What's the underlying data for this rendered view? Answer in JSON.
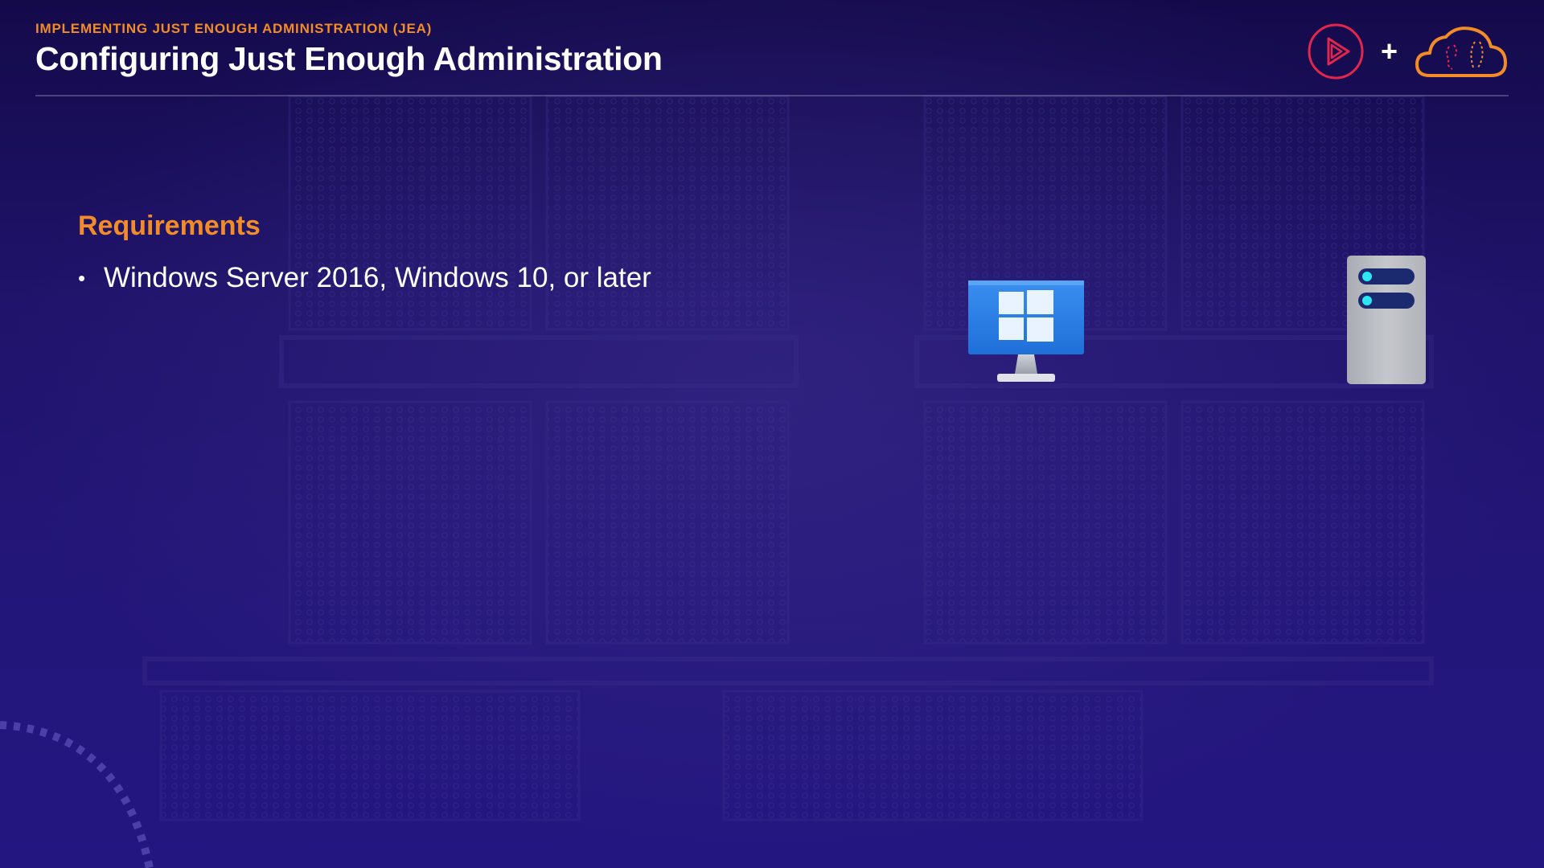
{
  "header": {
    "kicker": "IMPLEMENTING JUST ENOUGH ADMINISTRATION (JEA)",
    "title": "Configuring Just Enough Administration",
    "logos": {
      "left_icon": "pluralsight-play-icon",
      "separator": "+",
      "right_icon": "cloud-brain-icon"
    }
  },
  "content": {
    "heading": "Requirements",
    "bullets": [
      {
        "bullet": "•",
        "text": "Windows Server 2016, Windows 10, or later"
      }
    ]
  },
  "illustrations": {
    "left": "windows-monitor-icon",
    "right": "server-tower-icon"
  },
  "colors": {
    "accent_orange": "#f28c28",
    "background": "#1f136b",
    "title_text": "#ffffff",
    "play_logo": "#e2264d",
    "windows_blue": "#2b7de9",
    "server_led": "#2ee6f0"
  }
}
